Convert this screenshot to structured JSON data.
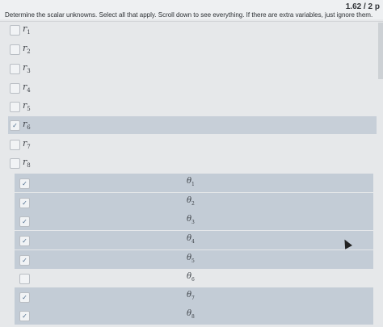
{
  "header": {
    "score": "1.62 / 2 p",
    "prompt": "Determine the scalar unknowns. Select all that apply. Scroll down to see everything. If there are extra variables, just ignore them."
  },
  "r_vars": [
    {
      "base": "r",
      "sub": "1",
      "checked": false
    },
    {
      "base": "r",
      "sub": "2",
      "checked": false
    },
    {
      "base": "r",
      "sub": "3",
      "checked": false
    },
    {
      "base": "r",
      "sub": "4",
      "checked": false
    },
    {
      "base": "r",
      "sub": "5",
      "checked": false
    },
    {
      "base": "r",
      "sub": "6",
      "checked": true
    },
    {
      "base": "r",
      "sub": "7",
      "checked": false
    },
    {
      "base": "r",
      "sub": "8",
      "checked": false
    }
  ],
  "theta_vars": [
    {
      "base": "θ",
      "sub": "1",
      "checked": true
    },
    {
      "base": "θ",
      "sub": "2",
      "checked": true
    },
    {
      "base": "θ",
      "sub": "3",
      "checked": true
    },
    {
      "base": "θ",
      "sub": "4",
      "checked": true
    },
    {
      "base": "θ",
      "sub": "5",
      "checked": true
    },
    {
      "base": "θ",
      "sub": "6",
      "checked": false
    },
    {
      "base": "θ",
      "sub": "7",
      "checked": true
    },
    {
      "base": "θ",
      "sub": "8",
      "checked": true
    }
  ],
  "icons": {
    "check": "✓",
    "cursor": "mouse-pointer-icon"
  }
}
